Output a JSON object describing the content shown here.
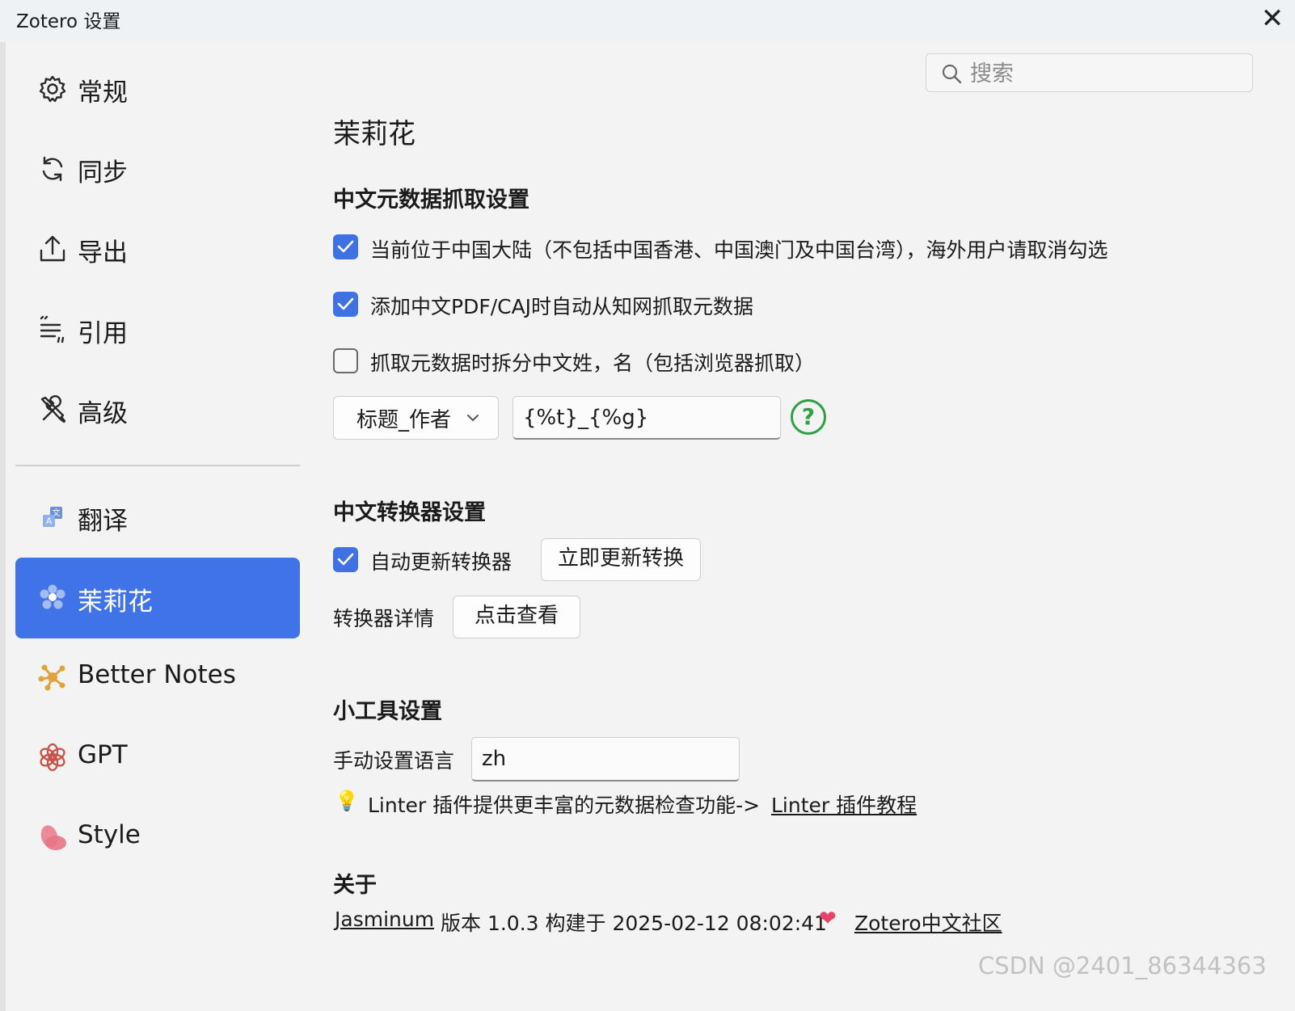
{
  "window": {
    "title": "Zotero 设置",
    "close_glyph": "✕"
  },
  "sidebar": {
    "items": [
      {
        "label": "常规",
        "icon": "gear-icon"
      },
      {
        "label": "同步",
        "icon": "sync-icon"
      },
      {
        "label": "导出",
        "icon": "export-icon"
      },
      {
        "label": "引用",
        "icon": "cite-icon"
      },
      {
        "label": "高级",
        "icon": "tools-icon"
      },
      {
        "label": "翻译",
        "icon": "translate-icon"
      },
      {
        "label": "茉莉花",
        "icon": "jasmine-flower-icon",
        "active": true
      },
      {
        "label": "Better Notes",
        "icon": "better-notes-icon"
      },
      {
        "label": "GPT",
        "icon": "gpt-icon"
      },
      {
        "label": "Style",
        "icon": "style-icon"
      }
    ]
  },
  "search": {
    "placeholder": "搜索",
    "value": ""
  },
  "main": {
    "page_title": "茉莉花",
    "metadata": {
      "heading": "中文元数据抓取设置",
      "options": [
        {
          "label": "当前位于中国大陆（不包括中国香港、中国澳门及中国台湾），海外用户请取消勾选",
          "checked": true
        },
        {
          "label": "添加中文PDF/CAJ时自动从知网抓取元数据",
          "checked": true
        },
        {
          "label": "抓取元数据时拆分中文姓，名（包括浏览器抓取）",
          "checked": false
        }
      ],
      "rename_select": "标题_作者",
      "rename_pattern": "{%t}_{%g}",
      "help_glyph": "?"
    },
    "translator": {
      "heading": "中文转换器设置",
      "auto_update_label": "自动更新转换器",
      "auto_update_checked": true,
      "update_now_button": "立即更新转换",
      "details_label": "转换器详情",
      "details_button": "点击查看"
    },
    "tools": {
      "heading": "小工具设置",
      "language_label": "手动设置语言",
      "language_value": "zh",
      "tip_icon": "💡",
      "tip_text": "Linter 插件提供更丰富的元数据检查功能->",
      "tip_link": "Linter 插件教程"
    },
    "about": {
      "heading": "关于",
      "name_link": "Jasminum",
      "version_text": "版本 1.0.3 构建于 2025-02-12 08:02:41",
      "heart": "❤",
      "community_link": "Zotero中文社区"
    }
  },
  "watermark": "CSDN @2401_86344363",
  "colors": {
    "accent": "#4073e8",
    "link": "#1a56c8",
    "help": "#2ea043",
    "heart": "#e8426b"
  }
}
